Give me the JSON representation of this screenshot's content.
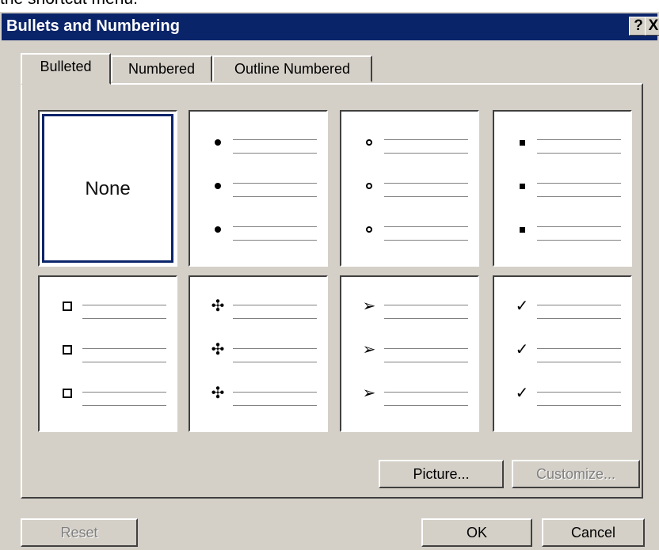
{
  "background_snippet": "the shortcut menu.",
  "dialog": {
    "title": "Bullets and Numbering",
    "help_label": "?",
    "close_label": "X"
  },
  "tabs": [
    {
      "label": "Bulleted"
    },
    {
      "label": "Numbered"
    },
    {
      "label": "Outline Numbered"
    }
  ],
  "gallery": {
    "none_label": "None",
    "cells": [
      "none",
      "solid-dot",
      "hollow-circle",
      "small-square",
      "box-square",
      "diamond-cluster",
      "arrow",
      "checkmark"
    ]
  },
  "buttons": {
    "picture": "Picture...",
    "customize": "Customize...",
    "reset": "Reset",
    "ok": "OK",
    "cancel": "Cancel"
  },
  "colors": {
    "titlebar": "#0a246a",
    "dialog_bg": "#d4d0c8"
  }
}
